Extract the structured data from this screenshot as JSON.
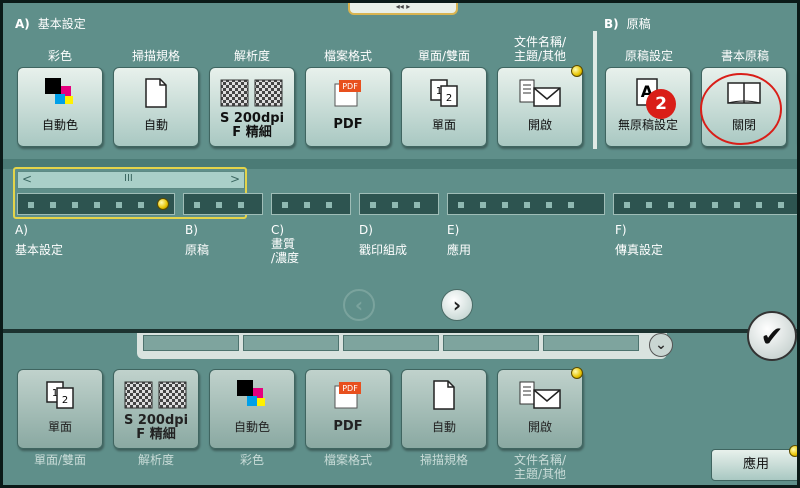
{
  "header": {
    "notch": "◂◂ ▸"
  },
  "section_a": {
    "letter": "A)",
    "title": "基本設定"
  },
  "section_b": {
    "letter": "B)",
    "title": "原稿"
  },
  "top_columns": [
    {
      "label": "彩色",
      "value": "自動色",
      "icon": "color-icon"
    },
    {
      "label": "掃描規格",
      "value": "自動",
      "icon": "page-icon"
    },
    {
      "label": "解析度",
      "value": "S 200dpi\nF 精細",
      "icon": "resolution-icon"
    },
    {
      "label": "檔案格式",
      "value": "PDF",
      "icon": "pdf-icon"
    },
    {
      "label": "單面/雙面",
      "value": "單面",
      "icon": "simplex-icon"
    },
    {
      "label": "文件名稱/\n主題/其他",
      "value": "開啟",
      "icon": "mail-icon"
    },
    {
      "label": "原稿設定",
      "value": "無原稿設定",
      "icon": "original-icon"
    },
    {
      "label": "書本原稿",
      "value": "關閉",
      "icon": "book-icon"
    }
  ],
  "badge": {
    "number": "2",
    "color": "#d91e18"
  },
  "tabs": [
    {
      "letter": "A)",
      "label": "基本設定"
    },
    {
      "letter": "B)",
      "label": "原稿"
    },
    {
      "letter": "C)",
      "label": "畫質\n/濃度"
    },
    {
      "letter": "D)",
      "label": "戳印組成"
    },
    {
      "letter": "E)",
      "label": "應用"
    },
    {
      "letter": "F)",
      "label": "傳真設定"
    }
  ],
  "scroll": {
    "left": "<",
    "right": ">",
    "thumb": "III"
  },
  "nav": {
    "prev": "‹",
    "next": "›",
    "ok": "✔"
  },
  "bottom_columns": [
    {
      "label": "單面/雙面",
      "value": "單面",
      "icon": "simplex-icon"
    },
    {
      "label": "解析度",
      "value": "S 200dpi\nF 精細",
      "icon": "resolution-icon"
    },
    {
      "label": "彩色",
      "value": "自動色",
      "icon": "color-icon"
    },
    {
      "label": "檔案格式",
      "value": "PDF",
      "icon": "pdf-icon"
    },
    {
      "label": "掃描規格",
      "value": "自動",
      "icon": "page-icon"
    },
    {
      "label": "文件名稱/\n主題/其他",
      "value": "開啟",
      "icon": "mail-icon"
    }
  ],
  "apply": {
    "label": "應用"
  },
  "colors": {
    "panel": "#5f8f8a",
    "accent_yellow": "#e8c400",
    "badge_red": "#d91e18",
    "highlight": "#e4d44a"
  }
}
